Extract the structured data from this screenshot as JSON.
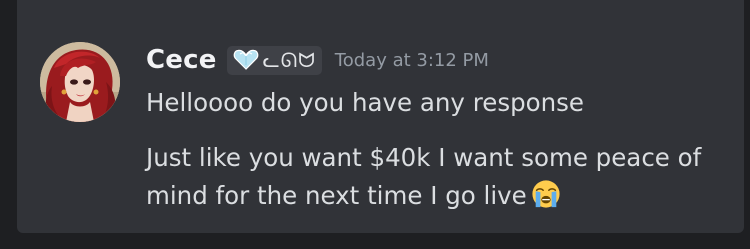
{
  "message": {
    "username": "Cece",
    "tag": {
      "icon": "heart-gem-icon",
      "text": "ᓚᘏᗢ"
    },
    "timestamp": "Today at 3:12 PM",
    "lines": [
      "Helloooo do you have any response",
      "Just like you want $40k I want some peace of mind for the next time I go live"
    ],
    "emoji": "loudly-crying-face-icon"
  },
  "colors": {
    "background": "#1e1f22",
    "panel": "#313338",
    "username": "#f2f3f5",
    "text": "#dbdee1",
    "timestamp": "#949ba4"
  }
}
